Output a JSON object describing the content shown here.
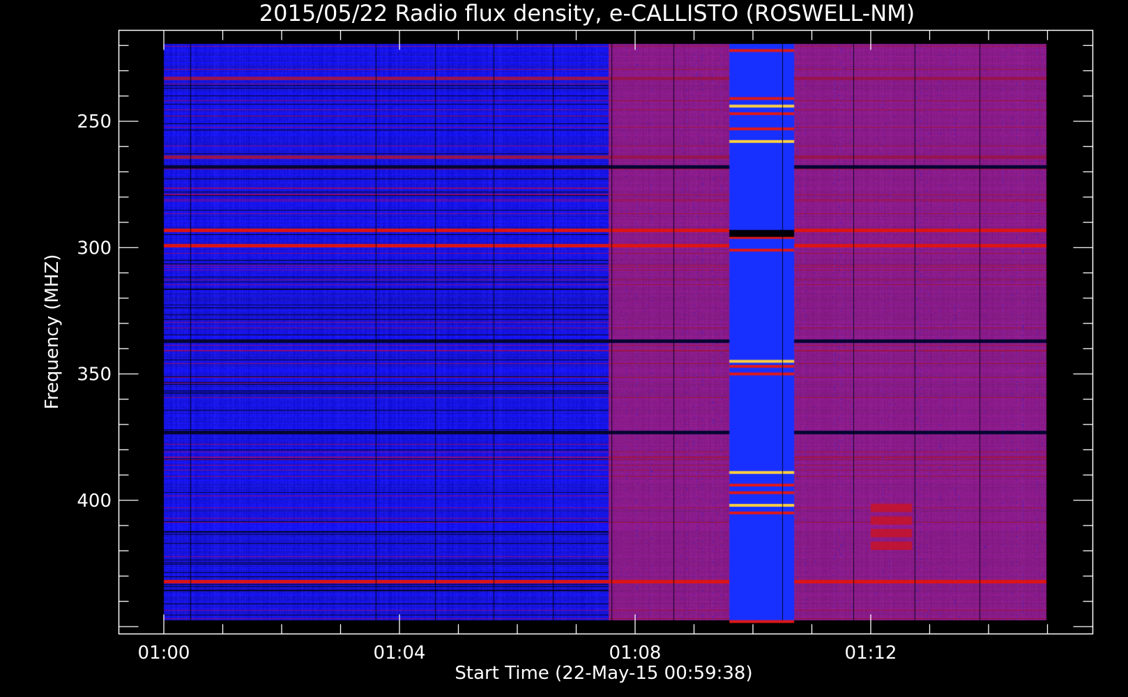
{
  "chart_data": {
    "type": "heatmap",
    "title": "2015/05/22  Radio flux density, e-CALLISTO (ROSWELL-NM)",
    "xlabel": "Start Time (22-May-15 00:59:38)",
    "ylabel": "Frequency (MHZ)",
    "x_range_minutes": [
      0,
      15
    ],
    "ylim": [
      218,
      463
    ],
    "y_inverted": true,
    "x_ticks": [
      {
        "label": "01:00",
        "minute": 0
      },
      {
        "label": "01:04",
        "minute": 4
      },
      {
        "label": "01:08",
        "minute": 8
      },
      {
        "label": "01:12",
        "minute": 12
      }
    ],
    "y_ticks": [
      {
        "label": "250",
        "mhz": 250
      },
      {
        "label": "300",
        "mhz": 300
      },
      {
        "label": "350",
        "mhz": 350
      },
      {
        "label": "400",
        "mhz": 400
      }
    ],
    "colormap": [
      "#000000",
      "#1010ff",
      "#8a1a6a",
      "#e01010",
      "#ffff60"
    ],
    "segments": [
      {
        "from_min": 0.0,
        "to_min": 7.55,
        "baseline": "blue"
      },
      {
        "from_min": 7.55,
        "to_min": 15.0,
        "baseline": "purple"
      }
    ],
    "bursts": [
      {
        "from_min": 9.6,
        "to_min": 10.7,
        "channels_mhz": [
          222,
          241,
          244,
          247,
          253,
          258,
          296,
          301,
          345,
          347,
          350,
          389,
          394,
          397,
          402,
          405,
          448
        ],
        "intensity": "high"
      },
      {
        "from_min": 12.0,
        "to_min": 12.7,
        "channels_mhz": [
          403,
          408,
          413,
          418
        ],
        "intensity": "medium"
      }
    ],
    "persistent_lines_mhz": [
      {
        "mhz": 233,
        "level": "red-dim"
      },
      {
        "mhz": 264,
        "level": "red-dim"
      },
      {
        "mhz": 268,
        "level": "dark"
      },
      {
        "mhz": 293,
        "level": "red"
      },
      {
        "mhz": 299,
        "level": "red"
      },
      {
        "mhz": 337,
        "level": "dark"
      },
      {
        "mhz": 373,
        "level": "dark"
      },
      {
        "mhz": 432,
        "level": "red"
      },
      {
        "mhz": 461,
        "level": "dark"
      }
    ]
  }
}
